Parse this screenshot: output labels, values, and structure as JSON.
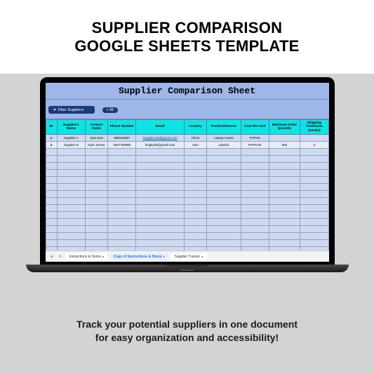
{
  "heading_line1": "SUPPLIER COMPARISON",
  "heading_line2": "GOOGLE SHEETS TEMPLATE",
  "sheet_title": "Supplier Comparison Sheet",
  "filter_label": "Filter Suppliers",
  "add_label": "+ 48",
  "columns": {
    "id": "ID",
    "name": "Supplier's Name",
    "contact": "Contact Name",
    "phone": "Phone Number",
    "email": "Email",
    "country": "Country",
    "product": "Product/Service",
    "cost": "Cost Per Unit",
    "moq": "Minimum Order Quantity",
    "ship": "Shipping Timeframe (weeks)"
  },
  "rows": [
    {
      "id": "1",
      "name": "Supplier A",
      "contact": "Jane Doe",
      "phone": "989324567",
      "email": "Supplier129@gmail.com",
      "country": "China",
      "product": "Laptop Cases",
      "cost": "PHP.00",
      "moq": "",
      "ship": ""
    },
    {
      "id": "2",
      "name": "Supplier B",
      "contact": "Kylie Jenner",
      "phone": "4057782980",
      "email": "kingkylie@gmail.com",
      "country": "USA",
      "product": "Lipstick",
      "cost": "PHP0.00",
      "moq": "500",
      "ship": "3"
    }
  ],
  "tabs": {
    "plus": "+",
    "t1": "Instructions & Demo",
    "t2": "Copy of Instructions & Demo",
    "t3": "Supplier Tracker"
  },
  "device": "MacBook Air",
  "tagline_1": "Track your potential suppliers in one document",
  "tagline_2": "for easy organization and accessibility!"
}
